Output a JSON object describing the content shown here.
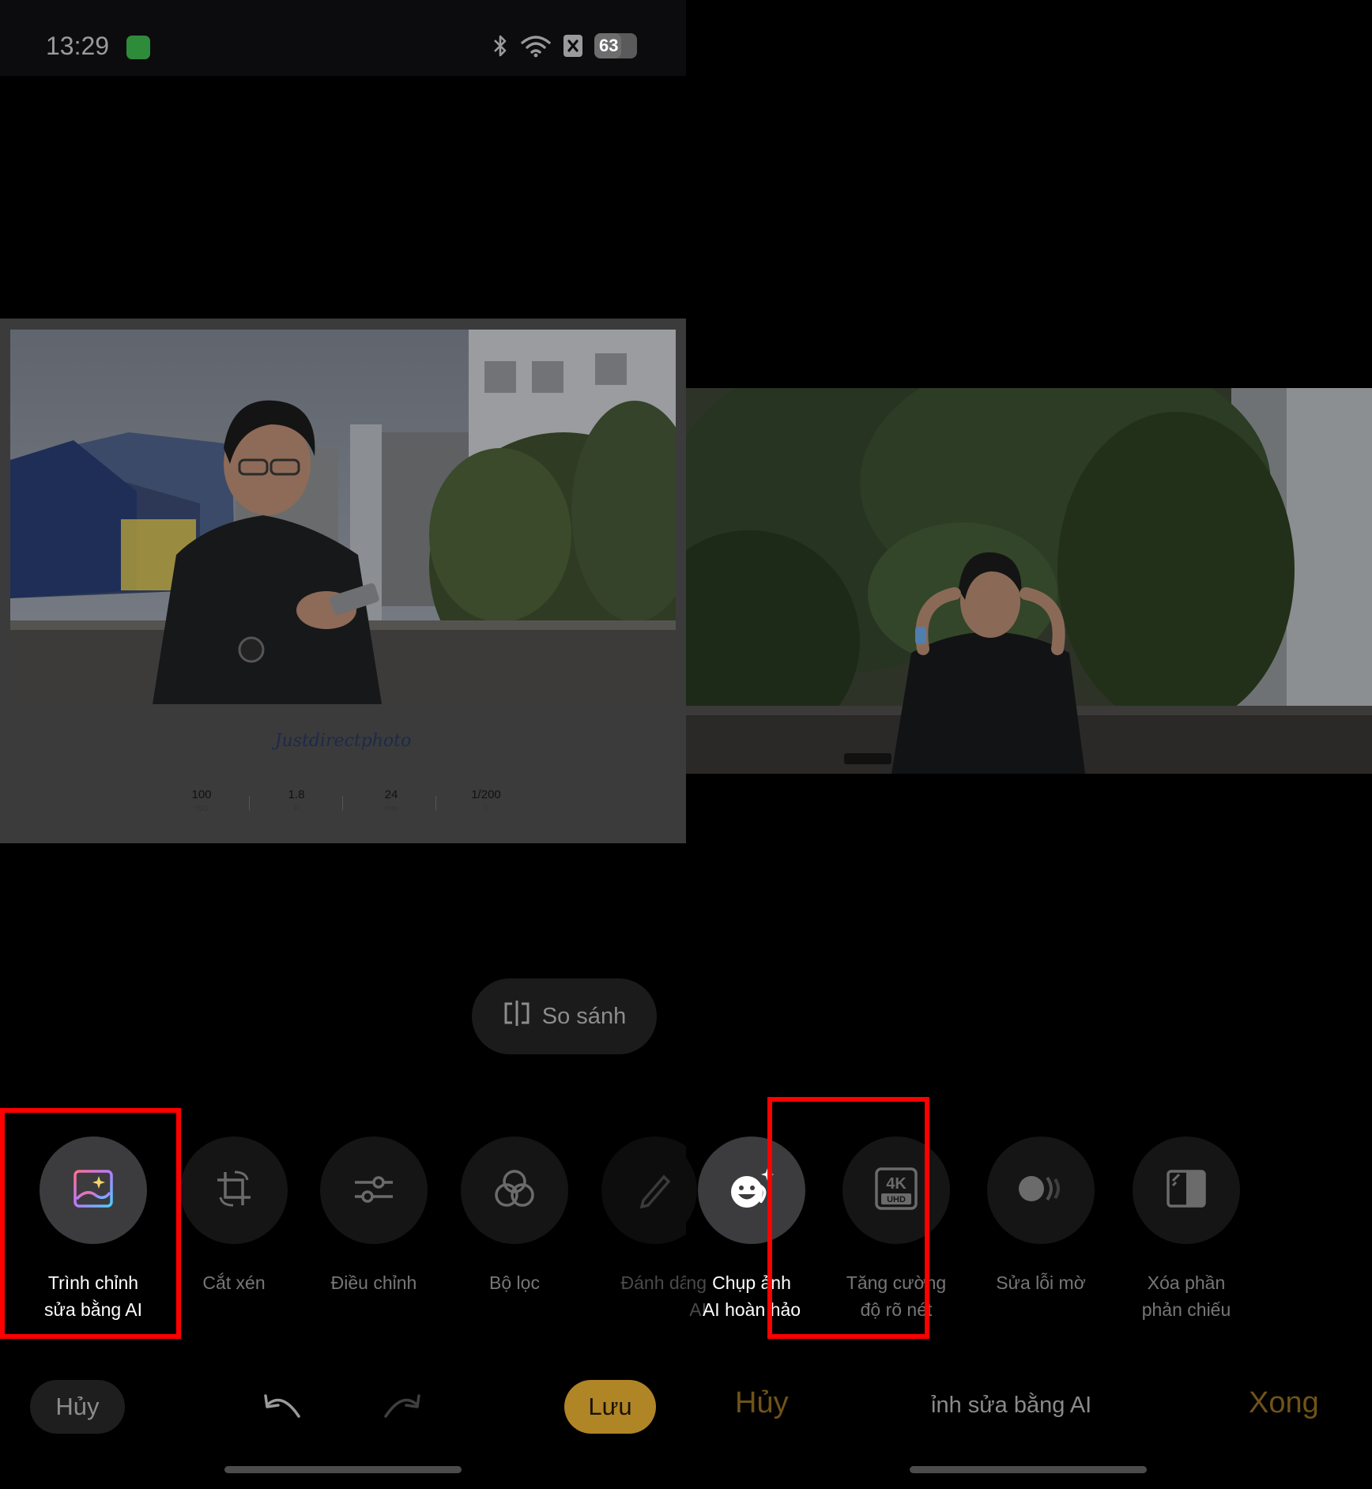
{
  "status_bar": {
    "time": "13:29",
    "battery": "63",
    "battery_level": 0.63
  },
  "left": {
    "photo": {
      "brand": "Justdirectphoto",
      "exif": [
        {
          "value": "100",
          "unit": "ISO"
        },
        {
          "value": "1.8",
          "unit": "F"
        },
        {
          "value": "24",
          "unit": "mm"
        },
        {
          "value": "1/200",
          "unit": "S"
        }
      ]
    },
    "compare_label": "So sánh",
    "tools": [
      {
        "label_line1": "Trình chỉnh",
        "label_line2": "sửa bằng AI",
        "icon": "ai-photo-edit-icon"
      },
      {
        "label_line1": "Cắt xén",
        "label_line2": "",
        "icon": "crop-rotate-icon"
      },
      {
        "label_line1": "Điều chỉnh",
        "label_line2": "",
        "icon": "sliders-icon"
      },
      {
        "label_line1": "Bộ lọc",
        "label_line2": "",
        "icon": "filter-circles-icon"
      },
      {
        "label_line1": "Đánh dấ",
        "label_line2": "",
        "icon": "markup-pen-icon"
      }
    ],
    "bottom_bar": {
      "cancel": "Hủy",
      "save": "Lưu"
    }
  },
  "right": {
    "tools": [
      {
        "label_line1": "sáng",
        "label_line2": "dung AI",
        "icon": "ai-portrait-light-icon"
      },
      {
        "label_line1": "Chụp ảnh",
        "label_line2": "AI hoàn hảo",
        "icon": "smiley-sparkle-icon"
      },
      {
        "label_line1": "Tăng cường",
        "label_line2": "độ rõ nét",
        "icon": "4k-uhd-icon"
      },
      {
        "label_line1": "Sửa lỗi mờ",
        "label_line2": "",
        "icon": "motion-deblur-icon"
      },
      {
        "label_line1": "Xóa phần",
        "label_line2": "phản chiếu",
        "icon": "reflection-remove-icon"
      }
    ],
    "bottom_bar": {
      "cancel": "Hủy",
      "title": "ỉnh sửa bằng AI",
      "done": "Xong"
    }
  },
  "colors": {
    "highlight": "#ff0000",
    "accent_gold": "#b08526",
    "background": "#000000"
  }
}
